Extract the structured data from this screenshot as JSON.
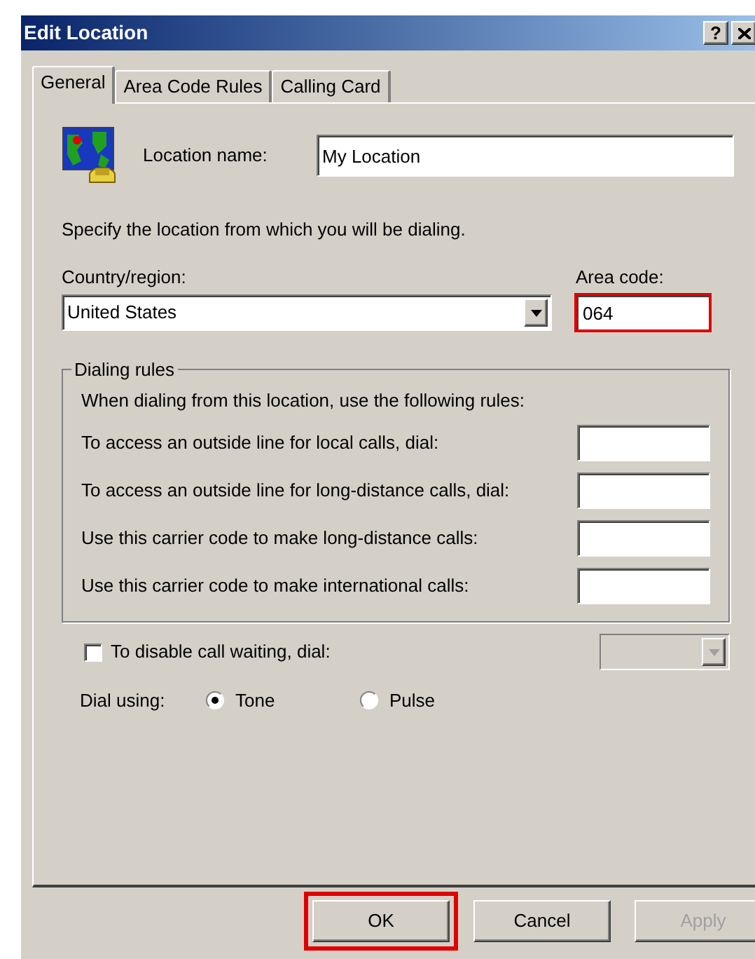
{
  "window": {
    "title": "Edit Location",
    "help_button": "?"
  },
  "tabs": [
    {
      "label": "General",
      "selected": true
    },
    {
      "label": "Area Code Rules",
      "selected": false
    },
    {
      "label": "Calling Card",
      "selected": false
    }
  ],
  "location_name": {
    "label": "Location name:",
    "value": "My Location"
  },
  "instruction": "Specify the location from which you will be dialing.",
  "country": {
    "label": "Country/region:",
    "value": "United States"
  },
  "area_code": {
    "label": "Area code:",
    "value": "064",
    "highlighted": true
  },
  "dialing_rules": {
    "title": "Dialing rules",
    "intro": "When dialing from this location, use the following rules:",
    "rows": [
      {
        "label": "To access an outside line for local calls, dial:"
      },
      {
        "label": "To access an outside line for long-distance calls, dial:"
      },
      {
        "label": "Use this carrier code to make long-distance calls:"
      },
      {
        "label": "Use this carrier code to make international calls:"
      }
    ]
  },
  "call_waiting": {
    "label": "To disable call waiting, dial:",
    "checked": false,
    "disabled": true
  },
  "dial_using": {
    "label": "Dial using:",
    "options": [
      {
        "label": "Tone",
        "selected": true
      },
      {
        "label": "Pulse",
        "selected": false
      }
    ]
  },
  "buttons": [
    {
      "label": "OK",
      "disabled": false,
      "highlighted": true
    },
    {
      "label": "Cancel",
      "disabled": false,
      "highlighted": false
    },
    {
      "label": "Apply",
      "disabled": true,
      "highlighted": false
    }
  ]
}
